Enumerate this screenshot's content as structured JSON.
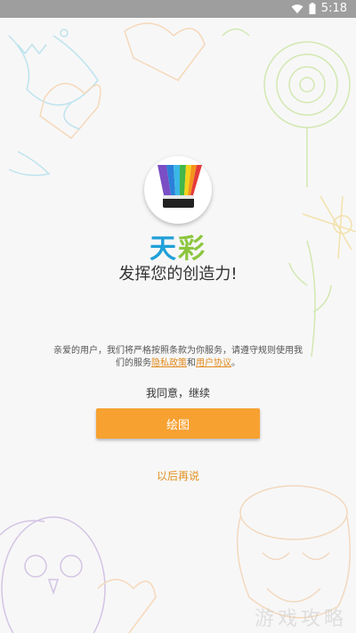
{
  "status": {
    "time": "5:18"
  },
  "app": {
    "name_part1": "天",
    "name_part2": "彩",
    "tagline": "发挥您的创造力!"
  },
  "notice": {
    "text_before": "亲爱的用户，我们将严格按照条款为你服务，请遵守规则使用我们的服务",
    "privacy_link": "隐私政策",
    "conjunction": "和",
    "terms_link": "用户协议",
    "end": "。"
  },
  "agree_text": "我同意，继续",
  "draw_button": "绘图",
  "later_link": "以后再说",
  "watermark": "游戏攻略",
  "colors": {
    "accent": "#f7a131",
    "statusbar": "#9e9e9e"
  }
}
